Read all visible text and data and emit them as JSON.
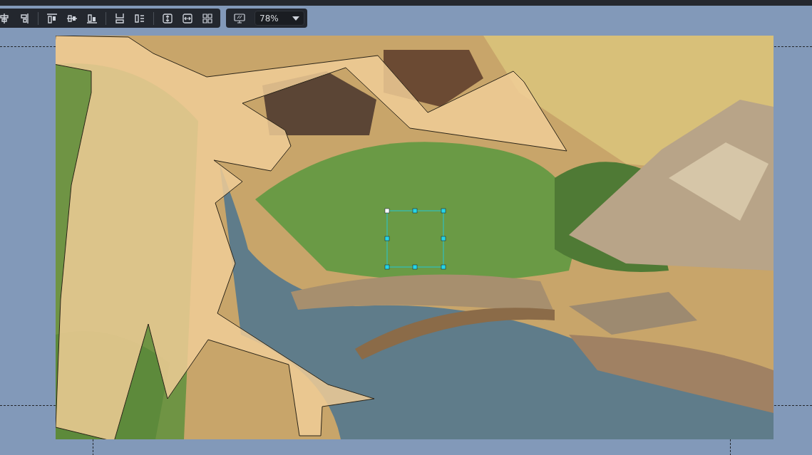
{
  "zoom": {
    "value": "78%"
  }
}
